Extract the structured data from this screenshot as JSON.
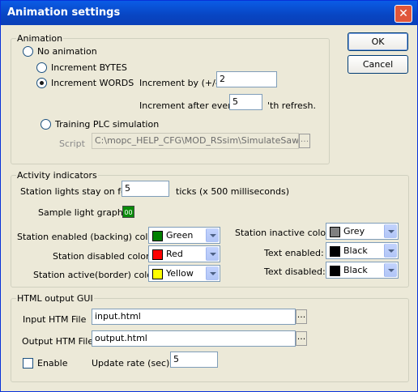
{
  "window": {
    "title": "Animation settings",
    "close_glyph": "✕"
  },
  "buttons": {
    "ok": "OK",
    "cancel": "Cancel"
  },
  "animation": {
    "legend": "Animation",
    "no_animation": "No animation",
    "increment_bytes": "Increment BYTES",
    "increment_words": "Increment WORDS",
    "increment_by_label": "Increment by (+/-)",
    "increment_by_value": "2",
    "increment_after_label": "Increment after every",
    "increment_after_value": "5",
    "refresh_suffix": "'th refresh.",
    "training_plc": "Training PLC simulation",
    "script_label": "Script",
    "script_value": "C:\\mopc_HELP_CFG\\MOD_RSsim\\SimulateSawToo...",
    "script_browse": "...",
    "selected": "increment_words"
  },
  "activity": {
    "legend": "Activity indicators",
    "lights_label": "Station lights stay on for",
    "lights_value": "5",
    "ticks_label": "ticks (x 500 milliseconds)",
    "sample_label": "Sample light graphic",
    "sample_text": "00",
    "enabled_label": "Station enabled (backing) color:",
    "enabled_value": "Green",
    "enabled_color": "#008000",
    "disabled_label": "Station disabled color:",
    "disabled_value": "Red",
    "disabled_color": "#ff0000",
    "active_label": "Station active(border) color:",
    "active_value": "Yellow",
    "active_color": "#ffff00",
    "inactive_label": "Station inactive color:",
    "inactive_value": "Grey",
    "inactive_color": "#808080",
    "text_enabled_label": "Text enabled:",
    "text_enabled_value": "Black",
    "text_enabled_color": "#000000",
    "text_disabled_label": "Text disabled:",
    "text_disabled_value": "Black",
    "text_disabled_color": "#000000"
  },
  "html_gui": {
    "legend": "HTML output GUI",
    "input_label": "Input HTM File",
    "input_value": "input.html",
    "output_label": "Output HTM File",
    "output_value": "output.html",
    "browse": "...",
    "enable_label": "Enable",
    "enable_checked": false,
    "update_label": "Update rate (sec)",
    "update_value": "5"
  }
}
